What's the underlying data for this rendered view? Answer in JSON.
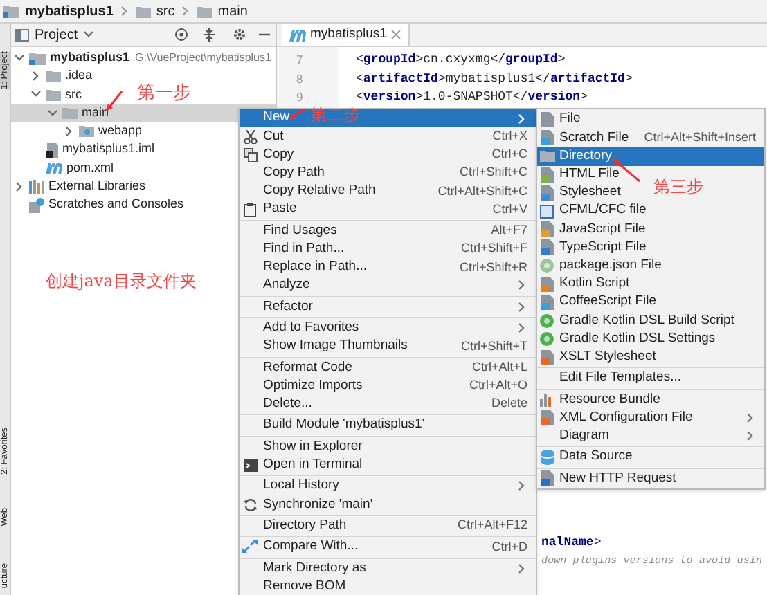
{
  "breadcrumb": [
    {
      "label": "mybatisplus1",
      "kind": "module"
    },
    {
      "label": "src",
      "kind": "folder"
    },
    {
      "label": "main",
      "kind": "folder"
    }
  ],
  "tool_strip": [
    {
      "label": "1: Project",
      "selected": true
    },
    {
      "label": "2: Favorites",
      "selected": false
    },
    {
      "label": "Web",
      "selected": false
    },
    {
      "label": "ucture",
      "selected": false
    }
  ],
  "project_panel": {
    "title": "Project",
    "tree": [
      {
        "label": "mybatisplus1",
        "path": "G:\\VueProject\\mybatisplus1",
        "kind": "module",
        "expanded": true,
        "selected": false,
        "children": [
          {
            "label": ".idea",
            "kind": "folder",
            "expanded": false,
            "selected": false
          },
          {
            "label": "src",
            "kind": "folder",
            "expanded": true,
            "selected": false,
            "children": [
              {
                "label": "main",
                "kind": "folder",
                "expanded": true,
                "selected": true,
                "children": [
                  {
                    "label": "webapp",
                    "kind": "webfolder",
                    "expanded": false,
                    "selected": false
                  }
                ]
              }
            ]
          },
          {
            "label": "mybatisplus1.iml",
            "kind": "iml",
            "selected": false
          },
          {
            "label": "pom.xml",
            "kind": "maven",
            "selected": false
          }
        ]
      },
      {
        "label": "External Libraries",
        "kind": "libraries",
        "expanded": false,
        "selected": false
      },
      {
        "label": "Scratches and Consoles",
        "kind": "scratches",
        "selected": false
      }
    ]
  },
  "editor": {
    "tab": "mybatisplus1",
    "lines": [
      {
        "number": "7",
        "code": "<groupId>cn.cxyxmg</groupId>"
      },
      {
        "number": "8",
        "code": "<artifactId>mybatisplus1</artifactId>"
      },
      {
        "number": "9",
        "code": "<version>1.0-SNAPSHOT</version>"
      }
    ],
    "fragments": [
      {
        "kind": "tag",
        "code": "nalName>"
      },
      {
        "kind": "comment",
        "code": "down plugins versions to avoid usin"
      }
    ]
  },
  "context_menu": [
    {
      "kind": "item",
      "label": "New",
      "submenu": true,
      "selected": true
    },
    {
      "kind": "item",
      "label": "Cut",
      "shortcut": "Ctrl+X",
      "selected": false
    },
    {
      "kind": "item",
      "label": "Copy",
      "shortcut": "Ctrl+C",
      "selected": false
    },
    {
      "kind": "item",
      "label": "Copy Path",
      "shortcut": "Ctrl+Shift+C",
      "selected": false
    },
    {
      "kind": "item",
      "label": "Copy Relative Path",
      "shortcut": "Ctrl+Alt+Shift+C",
      "selected": false
    },
    {
      "kind": "item",
      "label": "Paste",
      "shortcut": "Ctrl+V",
      "selected": false
    },
    {
      "kind": "separator"
    },
    {
      "kind": "item",
      "label": "Find Usages",
      "shortcut": "Alt+F7",
      "selected": false
    },
    {
      "kind": "item",
      "label": "Find in Path...",
      "shortcut": "Ctrl+Shift+F",
      "selected": false
    },
    {
      "kind": "item",
      "label": "Replace in Path...",
      "shortcut": "Ctrl+Shift+R",
      "selected": false
    },
    {
      "kind": "item",
      "label": "Analyze",
      "submenu": true,
      "selected": false
    },
    {
      "kind": "separator"
    },
    {
      "kind": "item",
      "label": "Refactor",
      "submenu": true,
      "selected": false
    },
    {
      "kind": "separator"
    },
    {
      "kind": "item",
      "label": "Add to Favorites",
      "submenu": true,
      "selected": false
    },
    {
      "kind": "item",
      "label": "Show Image Thumbnails",
      "shortcut": "Ctrl+Shift+T",
      "selected": false
    },
    {
      "kind": "separator"
    },
    {
      "kind": "item",
      "label": "Reformat Code",
      "shortcut": "Ctrl+Alt+L",
      "selected": false
    },
    {
      "kind": "item",
      "label": "Optimize Imports",
      "shortcut": "Ctrl+Alt+O",
      "selected": false
    },
    {
      "kind": "item",
      "label": "Delete...",
      "shortcut": "Delete",
      "selected": false
    },
    {
      "kind": "separator"
    },
    {
      "kind": "item",
      "label": "Build Module 'mybatisplus1'",
      "selected": false
    },
    {
      "kind": "separator"
    },
    {
      "kind": "item",
      "label": "Show in Explorer",
      "selected": false
    },
    {
      "kind": "item",
      "label": "Open in Terminal",
      "selected": false
    },
    {
      "kind": "separator"
    },
    {
      "kind": "item",
      "label": "Local History",
      "submenu": true,
      "selected": false
    },
    {
      "kind": "item",
      "label": "Synchronize 'main'",
      "selected": false
    },
    {
      "kind": "separator"
    },
    {
      "kind": "item",
      "label": "Directory Path",
      "shortcut": "Ctrl+Alt+F12",
      "selected": false
    },
    {
      "kind": "separator"
    },
    {
      "kind": "item",
      "label": "Compare With...",
      "shortcut": "Ctrl+D",
      "selected": false
    },
    {
      "kind": "separator"
    },
    {
      "kind": "item",
      "label": "Mark Directory as",
      "submenu": true,
      "selected": false
    },
    {
      "kind": "item",
      "label": "Remove BOM",
      "selected": false
    }
  ],
  "new_submenu": [
    {
      "kind": "item",
      "label": "File",
      "selected": false
    },
    {
      "kind": "item",
      "label": "Scratch File",
      "shortcut": "Ctrl+Alt+Shift+Insert",
      "selected": false
    },
    {
      "kind": "item",
      "label": "Directory",
      "selected": true
    },
    {
      "kind": "item",
      "label": "HTML File",
      "selected": false
    },
    {
      "kind": "item",
      "label": "Stylesheet",
      "selected": false
    },
    {
      "kind": "item",
      "label": "CFML/CFC file",
      "selected": false
    },
    {
      "kind": "item",
      "label": "JavaScript File",
      "selected": false
    },
    {
      "kind": "item",
      "label": "TypeScript File",
      "selected": false
    },
    {
      "kind": "item",
      "label": "package.json File",
      "selected": false
    },
    {
      "kind": "item",
      "label": "Kotlin Script",
      "selected": false
    },
    {
      "kind": "item",
      "label": "CoffeeScript File",
      "selected": false
    },
    {
      "kind": "item",
      "label": "Gradle Kotlin DSL Build Script",
      "selected": false
    },
    {
      "kind": "item",
      "label": "Gradle Kotlin DSL Settings",
      "selected": false
    },
    {
      "kind": "item",
      "label": "XSLT Stylesheet",
      "selected": false
    },
    {
      "kind": "separator"
    },
    {
      "kind": "item",
      "label": "Edit File Templates...",
      "selected": false
    },
    {
      "kind": "separator"
    },
    {
      "kind": "item",
      "label": "Resource Bundle",
      "selected": false
    },
    {
      "kind": "item",
      "label": "XML Configuration File",
      "submenu": true,
      "selected": false
    },
    {
      "kind": "item",
      "label": "Diagram",
      "submenu": true,
      "selected": false
    },
    {
      "kind": "separator"
    },
    {
      "kind": "item",
      "label": "Data Source",
      "selected": false
    },
    {
      "kind": "separator"
    },
    {
      "kind": "item",
      "label": "New HTTP Request",
      "selected": false
    }
  ],
  "annotations": [
    "第一步",
    "第二步",
    "第三步",
    "创建java目录文件夹"
  ]
}
